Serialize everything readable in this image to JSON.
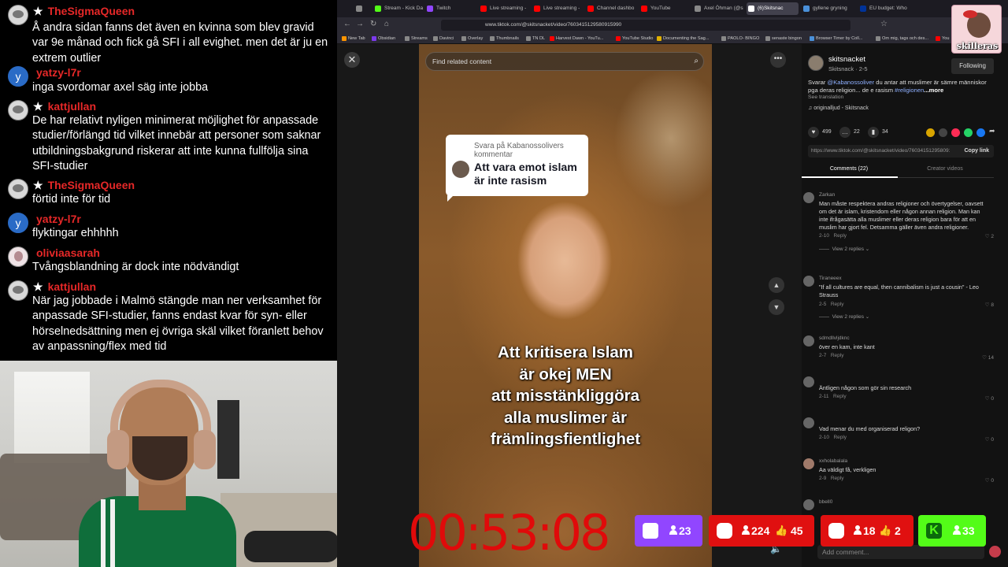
{
  "chat": {
    "messages": [
      {
        "user": "TheSigmaQueen",
        "text": "Å andra sidan fanns det även en kvinna som blev gravid var 9e månad och fick gå SFI i all evighet. men det är ju en extrem outlier",
        "avatar": "gray-avatar",
        "starred": true
      },
      {
        "user": "yatzy-l7r",
        "text": "inga svordomar axel säg inte jobba",
        "avatar": "y",
        "starred": false
      },
      {
        "user": "kattjullan",
        "text": "De har relativt nyligen minimerat möjlighet för anpassade studier/förlängd tid vilket innebär att personer som saknar utbildningsbakgrund riskerar att inte kunna fullfölja sina SFI-studier",
        "avatar": "gray-avatar",
        "starred": true
      },
      {
        "user": "TheSigmaQueen",
        "text": "förtid inte för tid",
        "avatar": "gray-avatar",
        "starred": true
      },
      {
        "user": "yatzy-l7r",
        "text": "flyktingar ehhhhh",
        "avatar": "y",
        "starred": false
      },
      {
        "user": "oliviaasarah",
        "text": "Tvångsblandning är dock inte nödvändigt",
        "avatar": "pink-avatar",
        "starred": false
      },
      {
        "user": "kattjullan",
        "text": "När jag jobbade i Malmö stängde man ner verksamhet för anpassade SFI-studier, fanns endast kvar för syn- eller hörselnedsättning men ej övriga skäl vilket föranlett behov av anpassning/flex med tid",
        "avatar": "gray-avatar",
        "starred": true
      }
    ]
  },
  "browser": {
    "tabs": [
      {
        "label": "",
        "color": "#888888"
      },
      {
        "label": "Stream - Kick Da",
        "color": "#53fc18"
      },
      {
        "label": "Twitch",
        "color": "#9146ff"
      },
      {
        "label": "Live streaming -",
        "color": "#ff0000"
      },
      {
        "label": "Live streaming -",
        "color": "#ff0000"
      },
      {
        "label": "Channel dashbo",
        "color": "#ff0000"
      },
      {
        "label": "YouTube",
        "color": "#ff0000"
      },
      {
        "label": "Axel Öhman (@s",
        "color": "#888888"
      },
      {
        "label": "(6)Skitsnac",
        "color": "#ffffff"
      },
      {
        "label": "gyllene gryning",
        "color": "#4a90d9"
      },
      {
        "label": "EU budget: Who",
        "color": "#003399"
      }
    ],
    "url": "www.tiktok.com/@skitsnacket/video/7603415129580915990",
    "bookmarks": [
      {
        "label": "New Tab",
        "color": "#ff9500"
      },
      {
        "label": "Obsidian",
        "color": "#7c3aed"
      },
      {
        "label": "Streams",
        "color": "#888888"
      },
      {
        "label": "Davinci",
        "color": "#888888"
      },
      {
        "label": "Overlay",
        "color": "#888888"
      },
      {
        "label": "Thumbnails",
        "color": "#888888"
      },
      {
        "label": "TN DL",
        "color": "#888888"
      },
      {
        "label": "Harvest Dawn - YouTu...",
        "color": "#ff0000"
      },
      {
        "label": "YouTube Studio",
        "color": "#ff0000"
      },
      {
        "label": "Documenting the Sag...",
        "color": "#e0b000"
      },
      {
        "label": "PAOLO- BINGO",
        "color": "#888888"
      },
      {
        "label": "senaste bingon",
        "color": "#888888"
      },
      {
        "label": "Browser Timer by Coll...",
        "color": "#4a90d9"
      },
      {
        "label": "Om mig, tags och des...",
        "color": "#888888"
      },
      {
        "label": "You",
        "color": "#ff0000"
      }
    ]
  },
  "viewer": {
    "search_placeholder": "Find related content",
    "reply_label": "Svara på      Kabanossolivers kommentar",
    "reply_text": "Att vara emot islam är inte rasism",
    "caption_lines": [
      "Att kritisera Islam",
      "är okej MEN",
      "att misstänkliggöra",
      "alla muslimer är",
      "främlingsfientlighet"
    ]
  },
  "post": {
    "author_name": "skitsnacket",
    "author_handle": "Skitsnack · 2-5",
    "follow_label": "Following",
    "description_prefix": "Svarar ",
    "description_mention": "@Kabanossoliver",
    "description_body": " du antar att muslimer är sämre människor pga deras religion... de e rasism",
    "description_tag": " #religionen",
    "description_more": "...more",
    "see_translation": "See translation",
    "sound": "♫ originalljud - Skitsnack",
    "likes": "499",
    "comments": "22",
    "saves": "34",
    "link": "https://www.tiktok.com/@skitsnacket/video/7603415129580915990",
    "copy_link": "Copy link",
    "tab_comments": "Comments (22)",
    "tab_creator": "Creator videos",
    "add_comment": "Add comment...",
    "share_colors": [
      "#d9a500",
      "#444444",
      "#fe2c55",
      "#25d366",
      "#1877f2"
    ]
  },
  "comments": [
    {
      "user": "Zarkan",
      "text": "Man måste respektera andras religioner och övertygelser, oavsett om det är islam, kristendom eller någon annan religion. Man kan inte ifrågasätta alla muslimer eller deras religion bara för att en muslim har gjort fel. Detsamma gäller även andra religioner.",
      "date": "2-10",
      "likes": "2",
      "replies": "View 2 replies"
    },
    {
      "user": "Tiraneeex",
      "text": "\"If all cultures are equal, then cannibalism is just a cousin\" - Leo Strauss",
      "date": "2-5",
      "likes": "8",
      "replies": "View 2 replies"
    },
    {
      "user": "sdmdllvljdknc",
      "text": "över en kam, inte kant",
      "date": "2-7",
      "likes": "14",
      "replies": ""
    },
    {
      "user": "",
      "text": "Äntligen någon som gör sin research",
      "date": "2-11",
      "likes": "0",
      "replies": ""
    },
    {
      "user": "",
      "text": "Vad menar du med organiserad religon?",
      "date": "2-10",
      "likes": "0",
      "replies": ""
    },
    {
      "user": "xxholabalala",
      "text": "Aa väldigt få, verkligen",
      "date": "2-9",
      "likes": "0",
      "replies": ""
    },
    {
      "user": "bbell0",
      "text": "",
      "date": "",
      "likes": "",
      "replies": ""
    }
  ],
  "comment_reply_label": "Reply",
  "logo": {
    "text": "skilleras"
  },
  "timer": "00:53:08",
  "stats": {
    "twitch": {
      "viewers": "23",
      "color": "#9146ff"
    },
    "youtube_1": {
      "viewers": "224",
      "likes": "45",
      "color": "#e01010"
    },
    "youtube_2": {
      "viewers": "18",
      "likes": "2",
      "color": "#e01010"
    },
    "kick": {
      "viewers": "33",
      "color": "#53fc18"
    }
  }
}
